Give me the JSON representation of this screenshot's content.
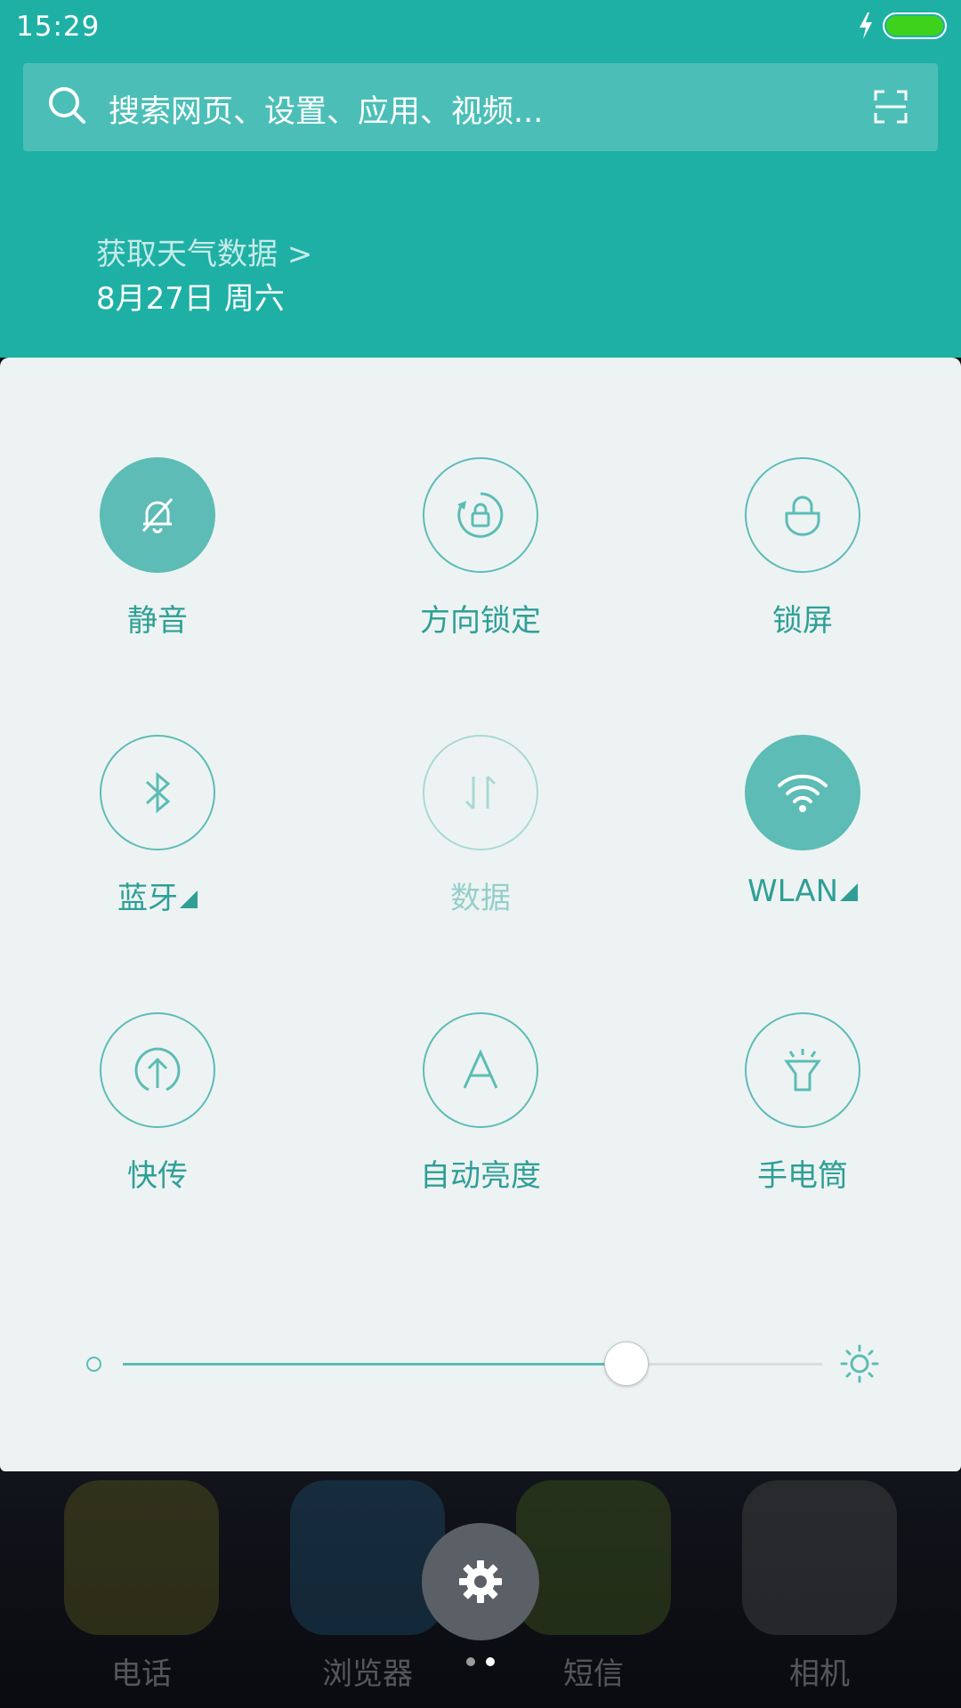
{
  "status_bar": {
    "time": "15:29",
    "charging_icon": "bolt-icon",
    "battery_color": "#3fd21c"
  },
  "search": {
    "placeholder": "搜索网页、设置、应用、视频...",
    "icon": "search-icon",
    "scan_icon": "scan-icon"
  },
  "weather": {
    "link": "获取天气数据 >",
    "date": "8月27日 周六"
  },
  "tiles": [
    {
      "label": "静音",
      "icon": "bell-off-icon",
      "state": "on"
    },
    {
      "label": "方向锁定",
      "icon": "rotation-lock-icon",
      "state": "off"
    },
    {
      "label": "锁屏",
      "icon": "lock-icon",
      "state": "off"
    },
    {
      "label": "蓝牙",
      "icon": "bluetooth-icon",
      "state": "off",
      "has_menu": true
    },
    {
      "label": "数据",
      "icon": "data-icon",
      "state": "disabled"
    },
    {
      "label": "WLAN",
      "icon": "wifi-icon",
      "state": "on",
      "has_menu": true
    },
    {
      "label": "快传",
      "icon": "upload-icon",
      "state": "off"
    },
    {
      "label": "自动亮度",
      "icon": "auto-brightness-icon",
      "state": "off"
    },
    {
      "label": "手电筒",
      "icon": "flashlight-icon",
      "state": "off"
    }
  ],
  "brightness": {
    "value": 0.72
  },
  "dock": [
    {
      "label": "电话",
      "color": "#6b6a1f"
    },
    {
      "label": "浏览器",
      "color": "#1f5a7a"
    },
    {
      "label": "短信",
      "color": "#4a6a1c"
    },
    {
      "label": "相机",
      "color": "#555555"
    }
  ],
  "colors": {
    "accent": "#5dbcb5",
    "top_bg": "#1fb0a5",
    "panel_bg": "#edf3f3"
  }
}
